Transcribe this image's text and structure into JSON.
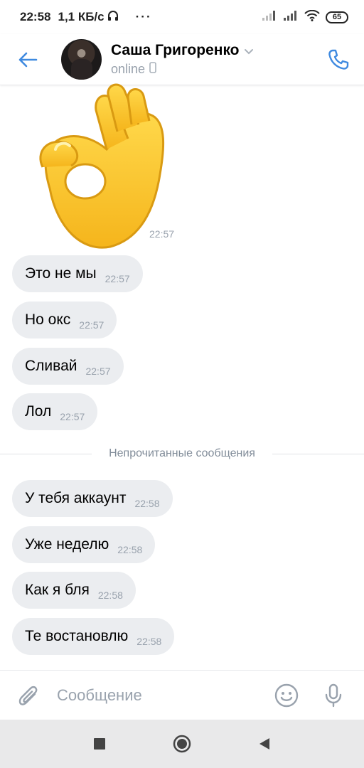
{
  "status_bar": {
    "time": "22:58",
    "speed": "1,1 КБ/с",
    "dots": "···",
    "battery": "65"
  },
  "header": {
    "contact_name": "Саша Григоренко",
    "status": "online"
  },
  "sticker": {
    "icon": "ok-hand-emoji",
    "time": "22:57"
  },
  "messages": [
    {
      "text": "Это не мы",
      "time": "22:57"
    },
    {
      "text": "Но окс",
      "time": "22:57"
    },
    {
      "text": "Сливай",
      "time": "22:57"
    },
    {
      "text": "Лол",
      "time": "22:57"
    },
    {
      "text": "У тебя аккаунт",
      "time": "22:58"
    },
    {
      "text": "Уже неделю",
      "time": "22:58"
    },
    {
      "text": "Как я бля",
      "time": "22:58"
    },
    {
      "text": "Те востановлю",
      "time": "22:58"
    }
  ],
  "unread_separator": "Непрочитанные сообщения",
  "composer": {
    "placeholder": "Сообщение"
  },
  "colors": {
    "accent": "#3f8ae0",
    "bubble": "#ebedf0",
    "secondary_text": "#99a2ad",
    "nav_bar": "#e9e9ea"
  }
}
